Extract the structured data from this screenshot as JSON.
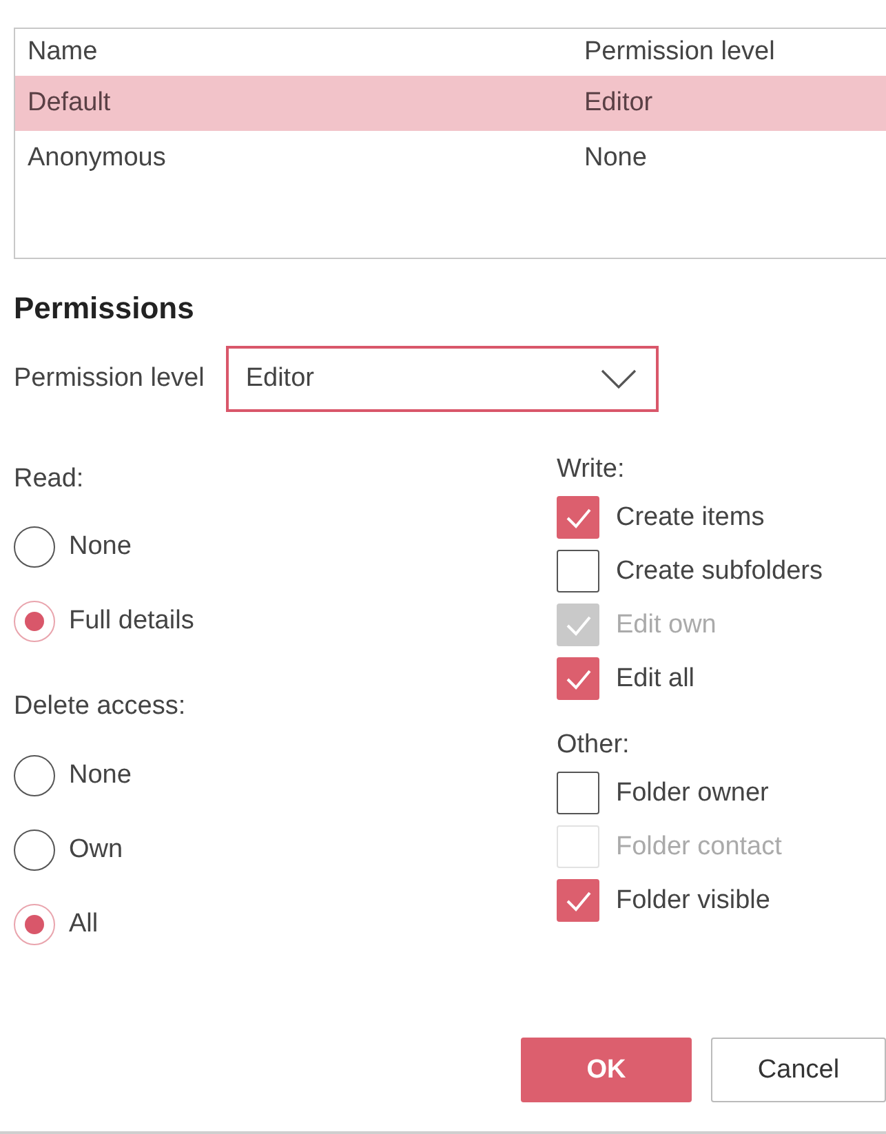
{
  "table": {
    "columns": [
      "Name",
      "Permission level"
    ],
    "rows": [
      {
        "cells": [
          "Default",
          "Editor"
        ],
        "selected": true
      },
      {
        "cells": [
          "Anonymous",
          "None"
        ],
        "selected": false
      }
    ]
  },
  "permissions": {
    "title": "Permissions",
    "level_label": "Permission level",
    "level_value": "Editor",
    "read": {
      "label": "Read:",
      "options": [
        {
          "label": "None",
          "selected": false
        },
        {
          "label": "Full details",
          "selected": true
        }
      ]
    },
    "delete_access": {
      "label": "Delete access:",
      "options": [
        {
          "label": "None",
          "selected": false
        },
        {
          "label": "Own",
          "selected": false
        },
        {
          "label": "All",
          "selected": true
        }
      ]
    },
    "write": {
      "label": "Write:",
      "options": [
        {
          "label": "Create items",
          "checked": true,
          "disabled": false
        },
        {
          "label": "Create subfolders",
          "checked": false,
          "disabled": false
        },
        {
          "label": "Edit own",
          "checked": true,
          "disabled": true
        },
        {
          "label": "Edit all",
          "checked": true,
          "disabled": false
        }
      ]
    },
    "other": {
      "label": "Other:",
      "options": [
        {
          "label": "Folder owner",
          "checked": false,
          "disabled": false
        },
        {
          "label": "Folder contact",
          "checked": false,
          "disabled": true
        },
        {
          "label": "Folder visible",
          "checked": true,
          "disabled": false
        }
      ]
    }
  },
  "buttons": [
    {
      "label": "OK",
      "kind": "primary"
    },
    {
      "label": "Cancel",
      "kind": "secondary"
    }
  ]
}
